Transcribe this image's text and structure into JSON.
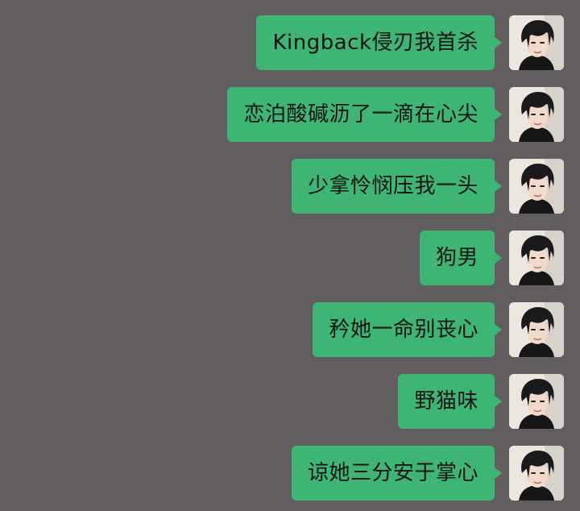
{
  "messages": [
    {
      "text": "Kingback侵刃我首杀",
      "sender": "self"
    },
    {
      "text": "恋泊酸碱沥了一滴在心尖",
      "sender": "self"
    },
    {
      "text": "少拿怜悯压我一头",
      "sender": "self"
    },
    {
      "text": "狗男",
      "sender": "self"
    },
    {
      "text": "矜她一命别丧心",
      "sender": "self"
    },
    {
      "text": "野猫味",
      "sender": "self"
    },
    {
      "text": "谅她三分安于掌心",
      "sender": "self"
    }
  ],
  "colors": {
    "background": "#625d5f",
    "bubble": "#3eb575",
    "text": "#141414"
  },
  "icons": {
    "avatar": "user-avatar-photo"
  }
}
